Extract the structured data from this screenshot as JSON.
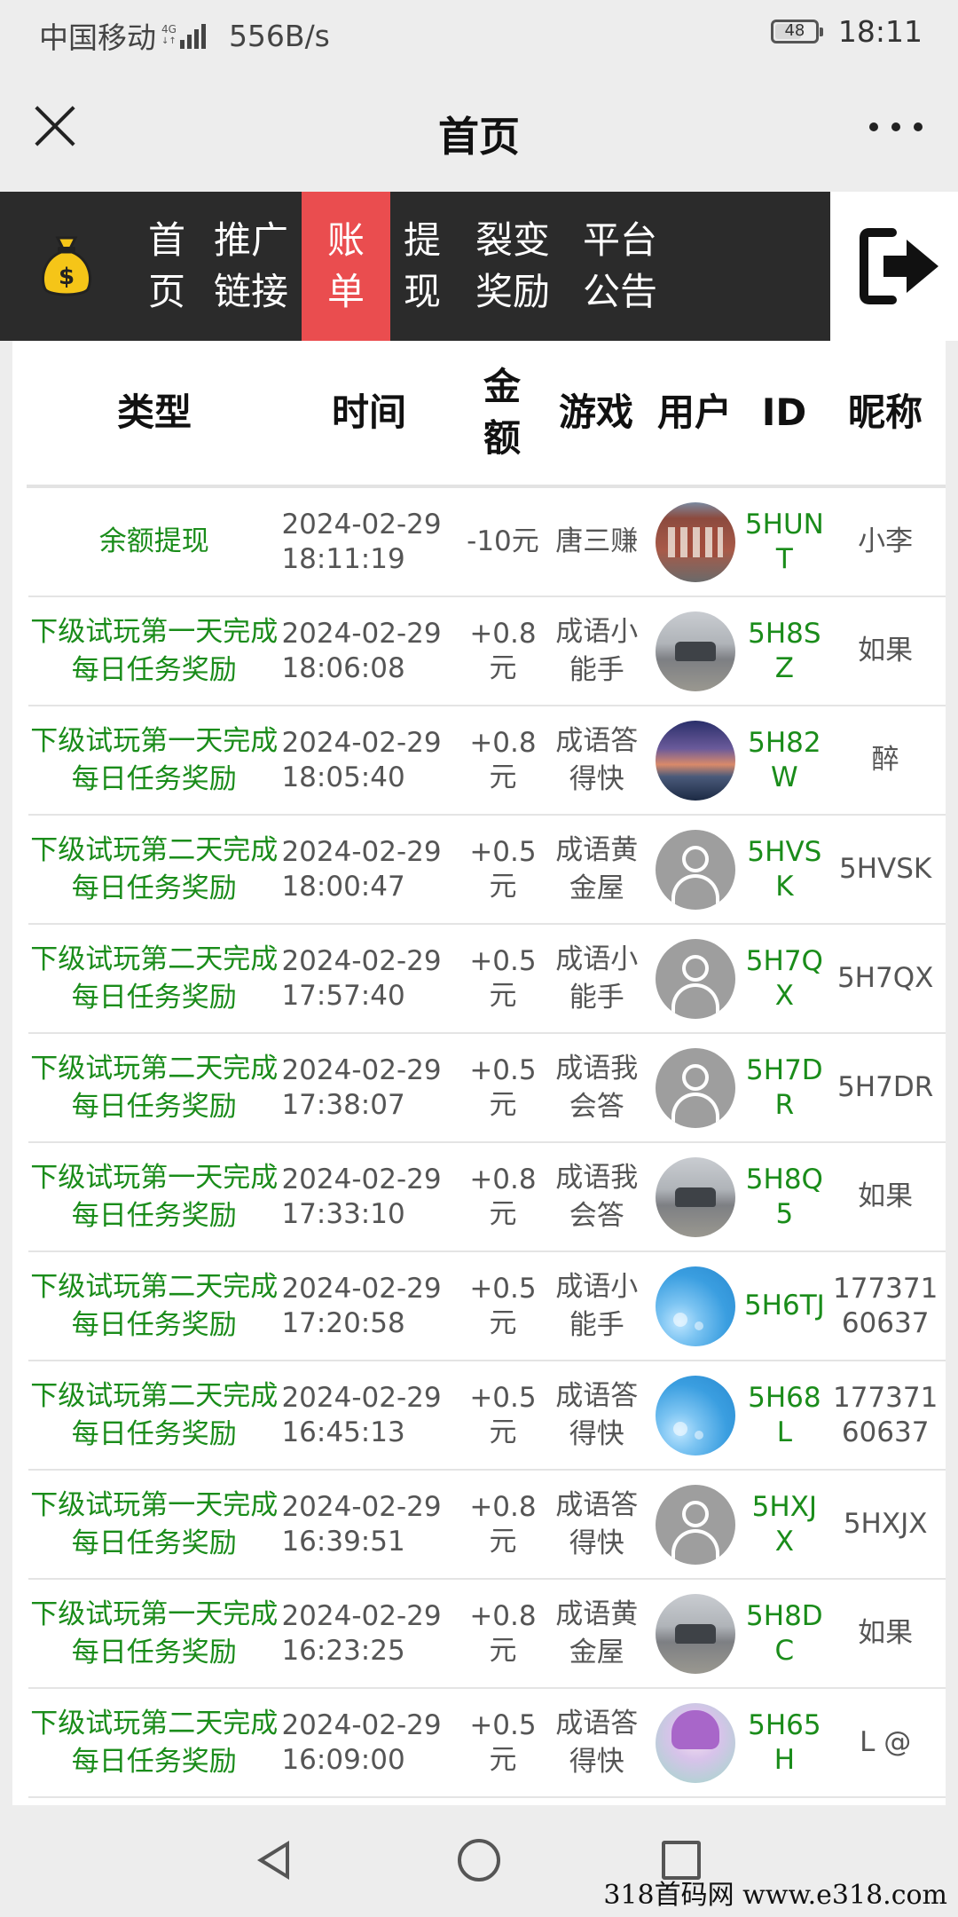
{
  "status_bar": {
    "carrier": "中国移动",
    "network_tag_top": "4G",
    "network_tag_bottom": "↓↑",
    "speed": "556B/s",
    "battery": "48",
    "time": "18:11"
  },
  "title_bar": {
    "title": "首页"
  },
  "nav": {
    "items": [
      {
        "label": "首\n页",
        "active": false
      },
      {
        "label": "推广\n链接",
        "active": false
      },
      {
        "label": "账\n单",
        "active": true
      },
      {
        "label": "提\n现",
        "active": false
      },
      {
        "label": "裂变\n奖励",
        "active": false
      },
      {
        "label": "平台\n公告",
        "active": false
      }
    ]
  },
  "table": {
    "headers": {
      "type": "类型",
      "time": "时间",
      "amount": "金\n额",
      "game": "游戏",
      "user": "用户",
      "id": "ID",
      "nickname": "昵称"
    },
    "rows": [
      {
        "type": "余额提现",
        "time": "2024-02-29 18:11:19",
        "amount": "-10元",
        "game": "唐三赚",
        "avatar": "building-photo",
        "id": "5HUNT",
        "nickname": "小李"
      },
      {
        "type": "下级试玩第一天完成每日任务奖励",
        "time": "2024-02-29 18:06:08",
        "amount": "+0.8元",
        "game": "成语小能手",
        "avatar": "car-photo",
        "id": "5H8SZ",
        "nickname": "如果"
      },
      {
        "type": "下级试玩第一天完成每日任务奖励",
        "time": "2024-02-29 18:05:40",
        "amount": "+0.8元",
        "game": "成语答得快",
        "avatar": "sunset-photo",
        "id": "5H82W",
        "nickname": "醉"
      },
      {
        "type": "下级试玩第二天完成每日任务奖励",
        "time": "2024-02-29 18:00:47",
        "amount": "+0.5元",
        "game": "成语黄金屋",
        "avatar": "default",
        "id": "5HVSK",
        "nickname": "5HVSK"
      },
      {
        "type": "下级试玩第二天完成每日任务奖励",
        "time": "2024-02-29 17:57:40",
        "amount": "+0.5元",
        "game": "成语小能手",
        "avatar": "default",
        "id": "5H7QX",
        "nickname": "5H7QX"
      },
      {
        "type": "下级试玩第二天完成每日任务奖励",
        "time": "2024-02-29 17:38:07",
        "amount": "+0.5元",
        "game": "成语我会答",
        "avatar": "default",
        "id": "5H7DR",
        "nickname": "5H7DR"
      },
      {
        "type": "下级试玩第一天完成每日任务奖励",
        "time": "2024-02-29 17:33:10",
        "amount": "+0.8元",
        "game": "成语我会答",
        "avatar": "car-photo",
        "id": "5H8Q5",
        "nickname": "如果"
      },
      {
        "type": "下级试玩第二天完成每日任务奖励",
        "time": "2024-02-29 17:20:58",
        "amount": "+0.5元",
        "game": "成语小能手",
        "avatar": "blue-bubbles",
        "id": "5H6TJ",
        "nickname": "17737160637"
      },
      {
        "type": "下级试玩第二天完成每日任务奖励",
        "time": "2024-02-29 16:45:13",
        "amount": "+0.5元",
        "game": "成语答得快",
        "avatar": "blue-bubbles",
        "id": "5H68L",
        "nickname": "17737160637"
      },
      {
        "type": "下级试玩第一天完成每日任务奖励",
        "time": "2024-02-29 16:39:51",
        "amount": "+0.8元",
        "game": "成语答得快",
        "avatar": "default",
        "id": "5HXJX",
        "nickname": "5HXJX"
      },
      {
        "type": "下级试玩第一天完成每日任务奖励",
        "time": "2024-02-29 16:23:25",
        "amount": "+0.8元",
        "game": "成语黄金屋",
        "avatar": "car-photo",
        "id": "5H8DC",
        "nickname": "如果"
      },
      {
        "type": "下级试玩第二天完成每日任务奖励",
        "time": "2024-02-29 16:09:00",
        "amount": "+0.5元",
        "game": "成语答得快",
        "avatar": "anime-girl",
        "id": "5H65H",
        "nickname": "L @"
      }
    ]
  },
  "watermark": "318首码网  www.e318.com",
  "colors": {
    "nav_bg": "#2b2b2b",
    "nav_active": "#ea4d4f",
    "green_text": "#1a8c1a",
    "money_bag": "#f5c518"
  }
}
